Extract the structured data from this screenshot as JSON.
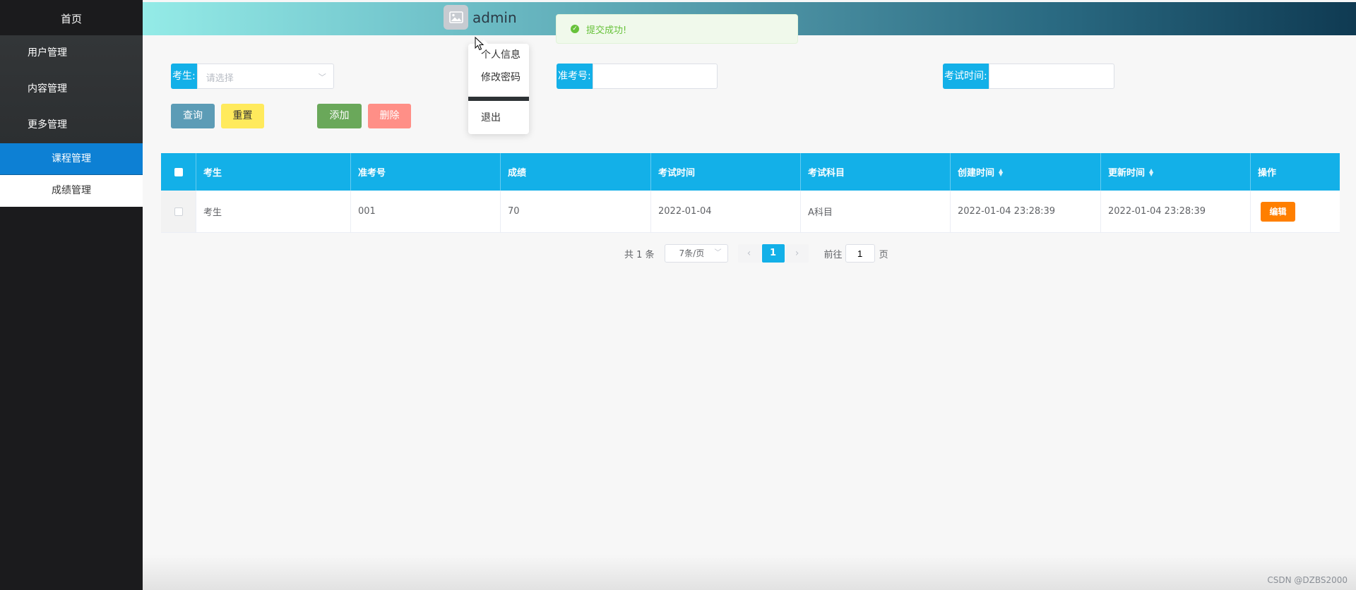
{
  "sidebar": {
    "home": "首页",
    "items": [
      "用户管理",
      "内容管理",
      "更多管理"
    ],
    "sub_items": [
      {
        "label": "课程管理",
        "active": true
      },
      {
        "label": "成绩管理",
        "active": false
      }
    ]
  },
  "header": {
    "username": "admin",
    "avatar_icon": "image-icon",
    "gradient": [
      "#94ebe7",
      "#0f3a52"
    ]
  },
  "toast": {
    "message": "提交成功!",
    "icon": "check-circle-icon",
    "color": "#67c23a"
  },
  "user_menu": {
    "items": [
      "个人信息",
      "修改密码"
    ],
    "logout": "退出"
  },
  "search": {
    "student_label": "考生:",
    "student_placeholder": "请选择",
    "ticket_label": "准考号:",
    "time_label": "考试时间:"
  },
  "actions": {
    "query": "查询",
    "reset": "重置",
    "add": "添加",
    "delete": "删除"
  },
  "table": {
    "columns": [
      "考生",
      "准考号",
      "成绩",
      "考试时间",
      "考试科目",
      "创建时间",
      "更新时间",
      "操作"
    ],
    "rows": [
      {
        "student": "考生",
        "ticket": "001",
        "score": "70",
        "exam_time": "2022-01-04",
        "subject": "A科目",
        "created": "2022-01-04 23:28:39",
        "updated": "2022-01-04 23:28:39",
        "edit": "编辑"
      }
    ]
  },
  "pagination": {
    "total": "共 1 条",
    "page_size": "7条/页",
    "current": "1",
    "goto_prefix": "前往",
    "goto_value": "1",
    "goto_suffix": "页"
  },
  "colors": {
    "accent": "#13b0e8",
    "sidebar_active": "#0d80d4",
    "edit": "#ff7f00"
  },
  "watermark": "CSDN @DZBS2000"
}
